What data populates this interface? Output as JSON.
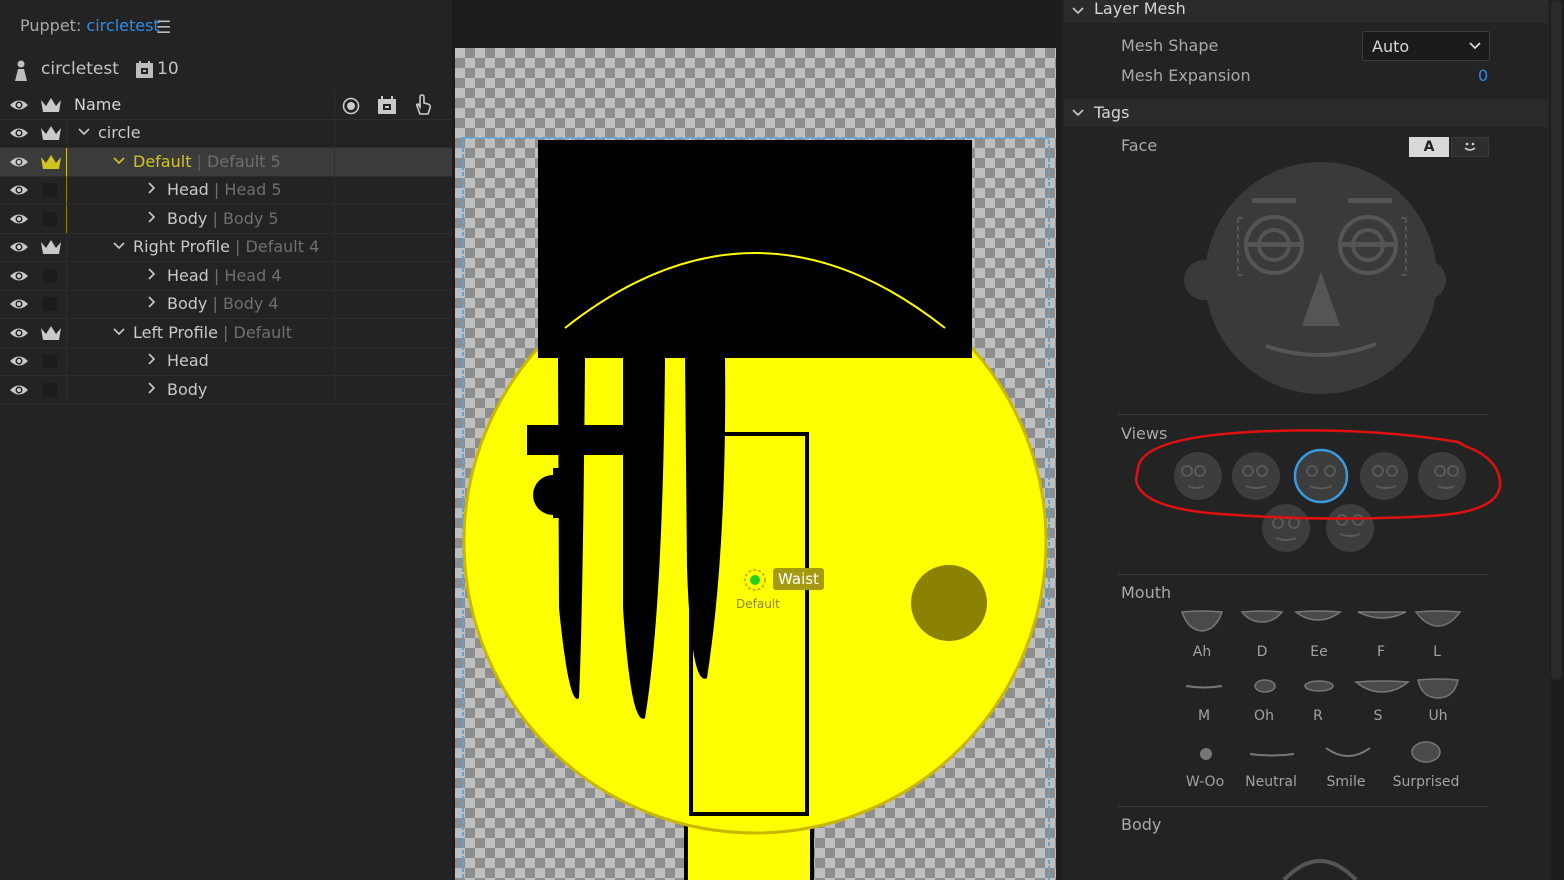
{
  "left_panel": {
    "title_prefix": "Puppet: ",
    "title_name": "circletest",
    "puppet_name": "circletest",
    "puppet_count": "10",
    "column_name": "Name",
    "rows": [
      {
        "label": "circle",
        "sub": ""
      },
      {
        "label": "Default",
        "sub": "Default 5"
      },
      {
        "label": "Head",
        "sub": "Head 5"
      },
      {
        "label": "Body",
        "sub": "Body 5"
      },
      {
        "label": "Right Profile",
        "sub": "Default 4"
      },
      {
        "label": "Head",
        "sub": "Head 4"
      },
      {
        "label": "Body",
        "sub": "Body 4"
      },
      {
        "label": "Left Profile",
        "sub": "Default"
      },
      {
        "label": "Head",
        "sub": ""
      },
      {
        "label": "Body",
        "sub": ""
      }
    ]
  },
  "canvas": {
    "handle_label": "Waist",
    "handle_sub": "Default"
  },
  "right_panel": {
    "layer_mesh_title": "Layer Mesh",
    "mesh_shape_label": "Mesh Shape",
    "mesh_shape_value": "Auto",
    "mesh_expansion_label": "Mesh Expansion",
    "mesh_expansion_value": "0",
    "tags_title": "Tags",
    "face_label": "Face",
    "face_toggle_text": "A",
    "views_label": "Views",
    "mouth_label": "Mouth",
    "mouth_shapes": [
      "Ah",
      "D",
      "Ee",
      "F",
      "L",
      "M",
      "Oh",
      "R",
      "S",
      "Uh",
      "W-Oo",
      "Neutral",
      "Smile",
      "Surprised"
    ],
    "body_label": "Body"
  },
  "colors": {
    "accent_blue": "#2d8ceb",
    "selected_yellow": "#d2c420",
    "puppet_yellow": "#ffff00",
    "annotation_red": "#e01010"
  }
}
